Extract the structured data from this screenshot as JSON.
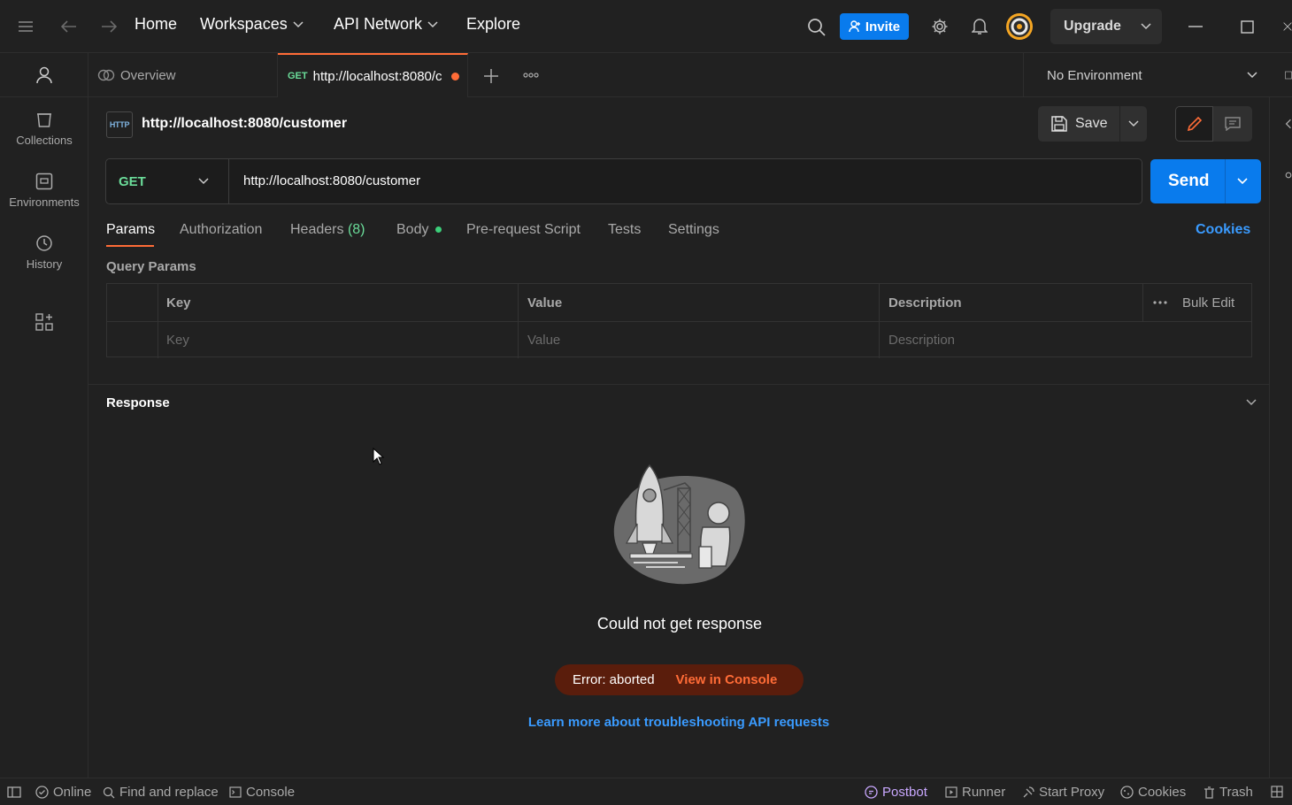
{
  "header": {
    "nav": [
      "Home",
      "Workspaces",
      "API Network",
      "Explore"
    ],
    "invite_label": "Invite",
    "upgrade_label": "Upgrade"
  },
  "sidebar": {
    "items": [
      {
        "label": "Collections",
        "icon": "trash-can-icon"
      },
      {
        "label": "Environments",
        "icon": "environment-icon"
      },
      {
        "label": "History",
        "icon": "history-icon"
      }
    ]
  },
  "tabs": {
    "overview_label": "Overview",
    "active_method": "GET",
    "active_label": "http://localhost:8080/c",
    "environment": "No Environment"
  },
  "request": {
    "title": "http://localhost:8080/customer",
    "save_label": "Save",
    "method": "GET",
    "url": "http://localhost:8080/customer",
    "send_label": "Send"
  },
  "subtabs": {
    "params": "Params",
    "authorization": "Authorization",
    "headers": "Headers",
    "headers_count": "(8)",
    "body": "Body",
    "prerequest": "Pre-request Script",
    "tests": "Tests",
    "settings": "Settings",
    "cookies": "Cookies"
  },
  "params": {
    "section_title": "Query Params",
    "columns": [
      "Key",
      "Value",
      "Description"
    ],
    "bulk_edit": "Bulk Edit",
    "placeholders": [
      "Key",
      "Value",
      "Description"
    ]
  },
  "response": {
    "title": "Response",
    "message": "Could not get response",
    "error_text": "Error: aborted",
    "console_link": "View in Console",
    "learn_more": "Learn more about troubleshooting API requests"
  },
  "statusbar": {
    "online": "Online",
    "find_replace": "Find and replace",
    "console": "Console",
    "postbot": "Postbot",
    "runner": "Runner",
    "start_proxy": "Start Proxy",
    "cookies": "Cookies",
    "trash": "Trash"
  },
  "colors": {
    "accent_blue": "#097bed",
    "method_get": "#6bdd9a",
    "error_bg": "#5a1d0c",
    "error_link": "#ff6c37",
    "unsaved_dot": "#ff6c37"
  }
}
